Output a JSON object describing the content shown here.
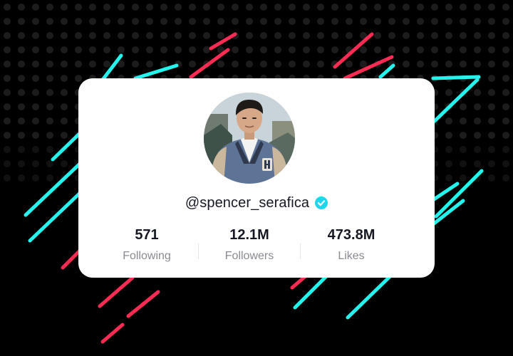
{
  "profile": {
    "handle": "@spencer_serafica",
    "verified": true
  },
  "stats": {
    "following": {
      "value": "571",
      "label": "Following"
    },
    "followers": {
      "value": "12.1M",
      "label": "Followers"
    },
    "likes": {
      "value": "473.8M",
      "label": "Likes"
    }
  },
  "colors": {
    "background": "#000000",
    "card": "#ffffff",
    "accent_cyan": "#25f4ee",
    "accent_red": "#fe2c55",
    "verified": "#20d5ec",
    "text_primary": "#161823",
    "text_secondary": "#8a8b91"
  },
  "icons": {
    "verified": "verified-badge-icon"
  }
}
